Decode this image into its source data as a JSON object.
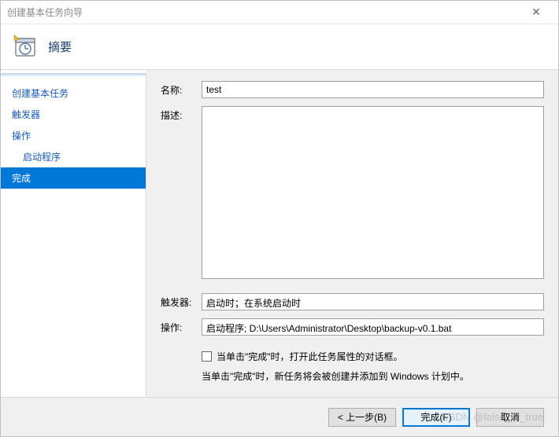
{
  "titlebar": {
    "title": "创建基本任务向导"
  },
  "header": {
    "title": "摘要"
  },
  "sidebar": {
    "items": [
      {
        "label": "创建基本任务",
        "indent": false,
        "selected": false
      },
      {
        "label": "触发器",
        "indent": false,
        "selected": false
      },
      {
        "label": "操作",
        "indent": false,
        "selected": false
      },
      {
        "label": "启动程序",
        "indent": true,
        "selected": false
      },
      {
        "label": "完成",
        "indent": false,
        "selected": true
      }
    ]
  },
  "form": {
    "name_label": "名称:",
    "name_value": "test",
    "desc_label": "描述:",
    "desc_value": "",
    "trigger_label": "触发器:",
    "trigger_value": "启动时；在系统启动时",
    "action_label": "操作:",
    "action_value": "启动程序; D:\\Users\\Administrator\\Desktop\\backup-v0.1.bat",
    "checkbox_label": "当单击\"完成\"时，打开此任务属性的对话框。",
    "hint": "当单击\"完成\"时，新任务将会被创建并添加到 Windows 计划中。"
  },
  "footer": {
    "back": "< 上一步(B)",
    "finish": "完成(F)",
    "cancel": "取消"
  },
  "watermark": "CSDN @false_or_true"
}
